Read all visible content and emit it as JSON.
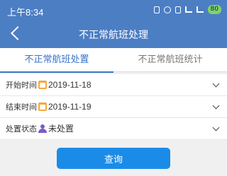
{
  "status_bar": {
    "time": "上午8:34",
    "battery": "80",
    "icons": [
      "bluetooth-icon",
      "alarm-icon",
      "vibrate-icon",
      "signal-icon",
      "wifi-icon",
      "battery-icon"
    ]
  },
  "nav": {
    "title": "不正常航班处理",
    "back_icon": "back-arrow-icon"
  },
  "tabs": [
    {
      "label": "不正常航班处置",
      "active": true
    },
    {
      "label": "不正常航班统计",
      "active": false
    }
  ],
  "filters": [
    {
      "label": "开始时间",
      "icon": "calendar-icon",
      "value": "2019-11-18"
    },
    {
      "label": "结束时间",
      "icon": "calendar-icon",
      "value": "2019-11-19"
    },
    {
      "label": "处置状态",
      "icon": "person-icon",
      "value": "未处置"
    }
  ],
  "query_button": {
    "label": "查询"
  },
  "colors": {
    "header": "#4c7ec4",
    "accent": "#3a74c8",
    "button": "#1a8ce8",
    "calendar": "#f4a93c",
    "person": "#7a5bc8"
  }
}
